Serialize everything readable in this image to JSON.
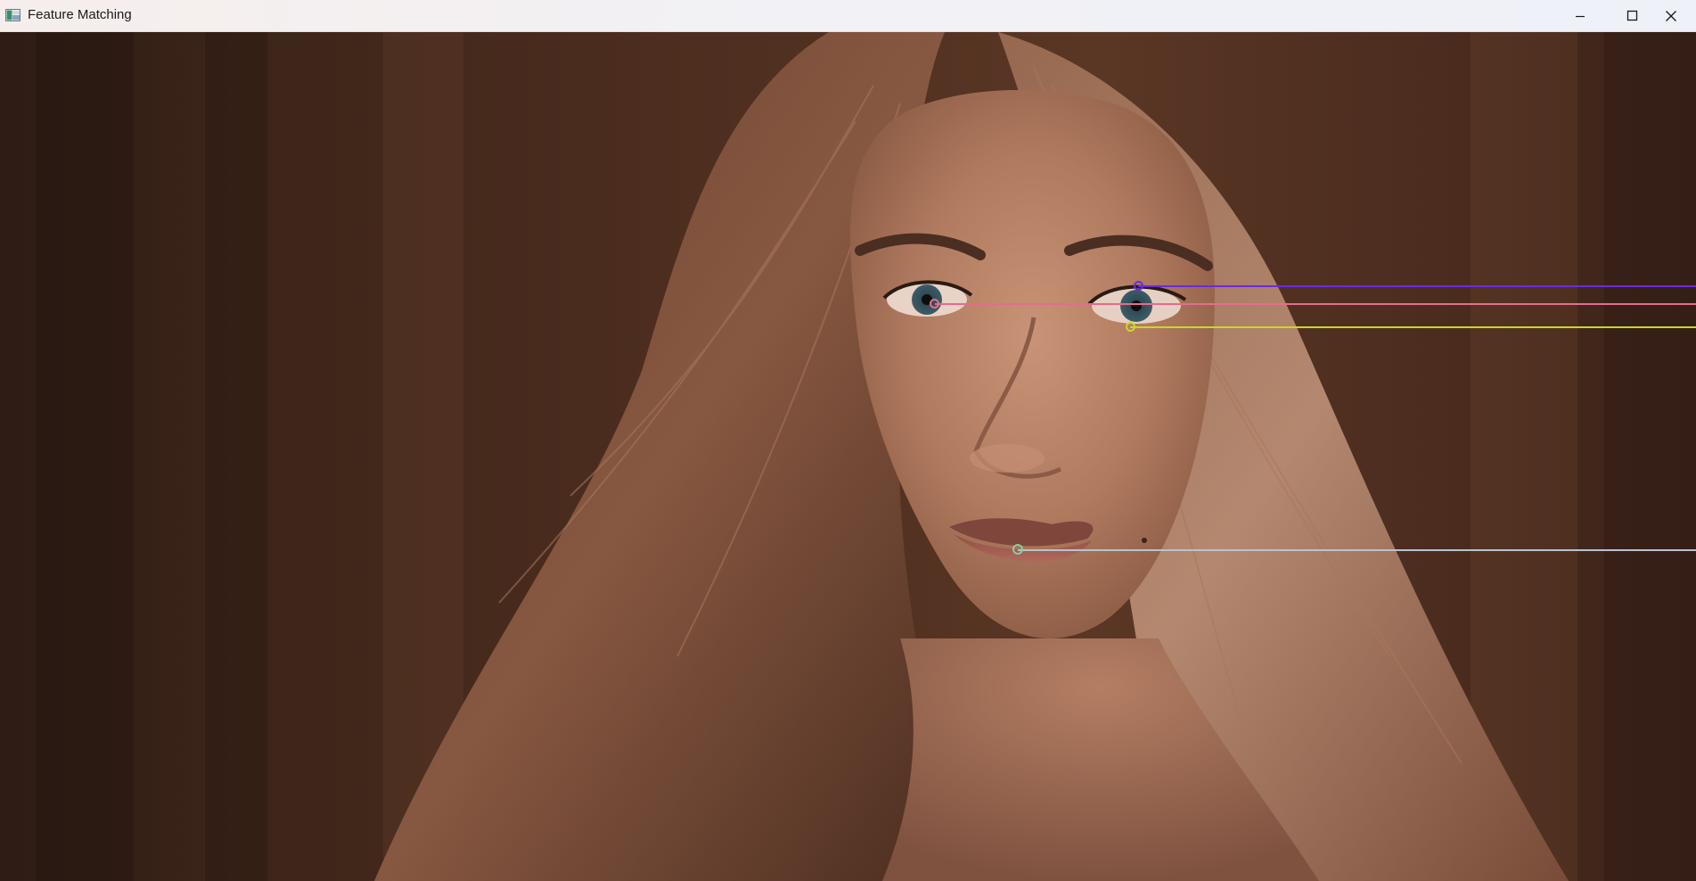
{
  "window": {
    "title": "Feature Matching",
    "icon": "opencv-window-icon",
    "controls": {
      "minimize": "minimize-icon",
      "maximize": "maximize-icon",
      "close": "close-icon"
    }
  },
  "canvas": {
    "content": "feature-matching-image",
    "matches": [
      {
        "name": "match-eye-upper",
        "color": "#6a2be0"
      },
      {
        "name": "match-eye-left",
        "color": "#e56d8b"
      },
      {
        "name": "match-eye-right",
        "color": "#c9d62b"
      },
      {
        "name": "match-lip",
        "color": "#b9c2cf"
      }
    ]
  }
}
